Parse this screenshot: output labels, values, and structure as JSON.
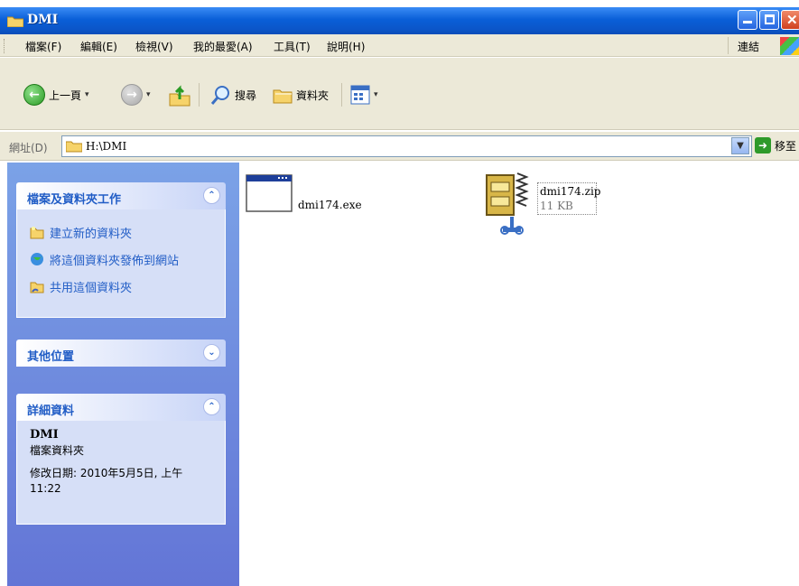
{
  "window": {
    "title": "DMI"
  },
  "menu": {
    "items": [
      "檔案(F)",
      "編輯(E)",
      "檢視(V)",
      "我的最愛(A)",
      "工具(T)",
      "說明(H)"
    ],
    "links_label": "連結"
  },
  "toolbar": {
    "back_label": "上一頁",
    "search_label": "搜尋",
    "folders_label": "資料夾"
  },
  "address": {
    "label": "網址(D)",
    "path": "H:\\DMI",
    "go_label": "移至"
  },
  "tasks_panel": {
    "title": "檔案及資料夾工作",
    "items": [
      "建立新的資料夾",
      "將這個資料夾發佈到網站",
      "共用這個資料夾"
    ]
  },
  "other_places_panel": {
    "title": "其他位置"
  },
  "details_panel": {
    "title": "詳細資料",
    "name": "DMI",
    "type": "檔案資料夾",
    "modified_line1": "修改日期: 2010年5月5日, 上午",
    "modified_line2": "11:22"
  },
  "files": [
    {
      "name": "dmi174.exe",
      "icon": "exe-window-icon"
    },
    {
      "name": "dmi174.zip",
      "size": "11 KB",
      "icon": "winzip-archive-icon"
    }
  ],
  "colors": {
    "title_bar": "#0a5fd8",
    "task_pane": "#7ba2e7",
    "panel_title": "#215dc6"
  }
}
